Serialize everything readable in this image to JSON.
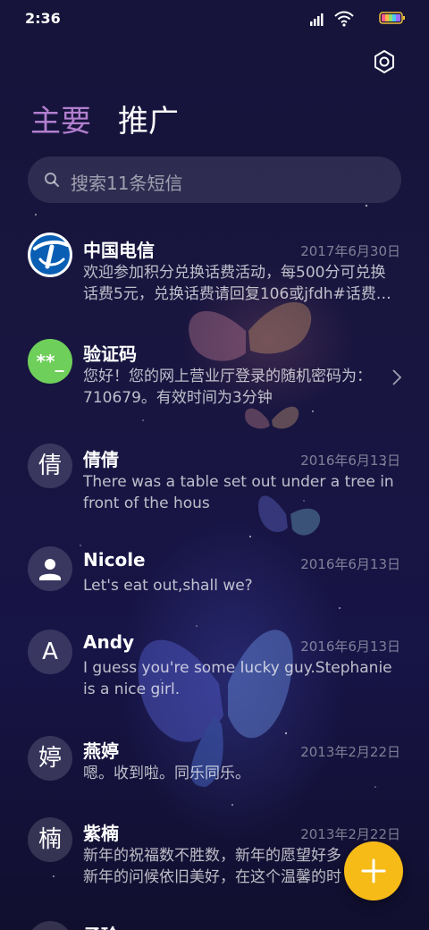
{
  "status_bar": {
    "time": "2:36",
    "icons": [
      "signal-icon",
      "wifi-icon",
      "battery-icon"
    ]
  },
  "header": {
    "settings_icon": "gear-icon",
    "tabs": [
      {
        "label": "主要",
        "active": true
      },
      {
        "label": "推广",
        "active": false
      }
    ]
  },
  "search": {
    "placeholder": "搜索11条短信"
  },
  "messages": [
    {
      "sender": "中国电信",
      "date": "2017年6月30日",
      "preview_lines": [
        "欢迎参加积分兑换话费活动，每500分可兑换",
        "话费5元，兑换话费请回复106或jfdh#话费…"
      ],
      "avatar": "china-telecom-logo"
    },
    {
      "sender": "验证码",
      "date": "",
      "preview_lines": [
        "您好！您的网上营业厅登录的随机密码为：",
        "710679。有效时间为3分钟"
      ],
      "avatar_text": "**_",
      "avatar_color": "#6ecf5a"
    },
    {
      "sender": "倩倩",
      "date": "2016年6月13日",
      "preview_lines": [
        "There was a table set out under a tree in",
        "front of the hous"
      ],
      "avatar_text": "倩"
    },
    {
      "sender": "Nicole",
      "date": "2016年6月13日",
      "preview_lines": [
        "Let's eat out,shall we?"
      ],
      "avatar": "person-icon"
    },
    {
      "sender": "Andy",
      "date": "2016年6月13日",
      "preview_lines": [
        "I guess you're some lucky guy.Stephanie",
        "is a nice girl."
      ],
      "avatar_text": "A"
    },
    {
      "sender": "燕婷",
      "date": "2013年2月22日",
      "preview_lines": [
        "嗯。收到啦。同乐同乐。"
      ],
      "avatar_text": "婷"
    },
    {
      "sender": "紫楠",
      "date": "2013年2月22日",
      "preview_lines": [
        "新年的祝福数不胜数，新年的愿望好多",
        "新年的问候依旧美好，在这个温馨的时"
      ],
      "avatar_text": "楠"
    },
    {
      "sender": "子玲",
      "date": "",
      "preview_lines": [],
      "avatar_text": ""
    }
  ],
  "fab": {
    "icon": "plus-icon",
    "color": "#f6bb17"
  },
  "colors": {
    "active_tab": "#b27fcf",
    "background": "#16143a"
  }
}
